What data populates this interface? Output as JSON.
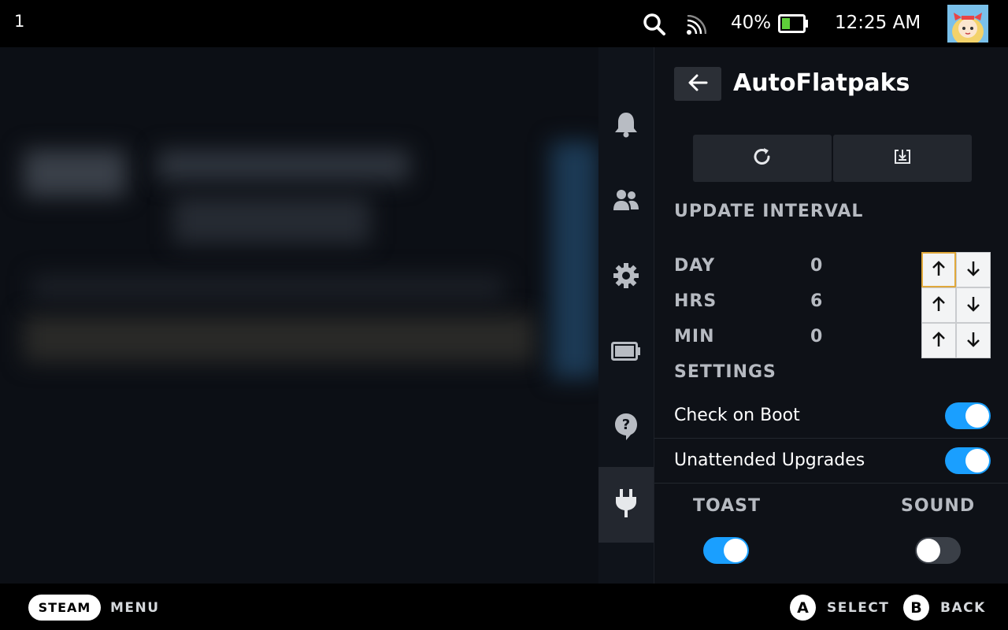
{
  "topbar": {
    "notification_count": "1",
    "battery_percent": "40%",
    "battery_level": 0.4,
    "time": "12:25 AM",
    "icons": [
      "search-icon",
      "signal-icon",
      "battery-icon"
    ]
  },
  "sidenav": {
    "items": [
      "bell-icon",
      "friends-icon",
      "gear-icon",
      "battery-icon",
      "help-icon",
      "plug-icon"
    ],
    "active": "plug-icon"
  },
  "panel": {
    "title": "AutoFlatpaks",
    "actions": [
      "refresh-icon",
      "download-icon"
    ],
    "update_interval": {
      "label": "UPDATE INTERVAL",
      "rows": [
        {
          "label": "DAY",
          "value": "0"
        },
        {
          "label": "HRS",
          "value": "6"
        },
        {
          "label": "MIN",
          "value": "0"
        }
      ]
    },
    "settings": {
      "label": "SETTINGS",
      "toggles": [
        {
          "label": "Check on Boot",
          "on": true
        },
        {
          "label": "Unattended Upgrades",
          "on": true
        }
      ],
      "columns": [
        {
          "label": "TOAST",
          "on": true
        },
        {
          "label": "SOUND",
          "on": false
        }
      ]
    }
  },
  "bottombar": {
    "steam_label": "STEAM",
    "menu_label": "MENU",
    "a_button": "A",
    "select_label": "SELECT",
    "b_button": "B",
    "back_label": "BACK"
  },
  "colors": {
    "accent": "#1a9fff",
    "focus": "#e0a83b",
    "label": "#b6bac1"
  }
}
